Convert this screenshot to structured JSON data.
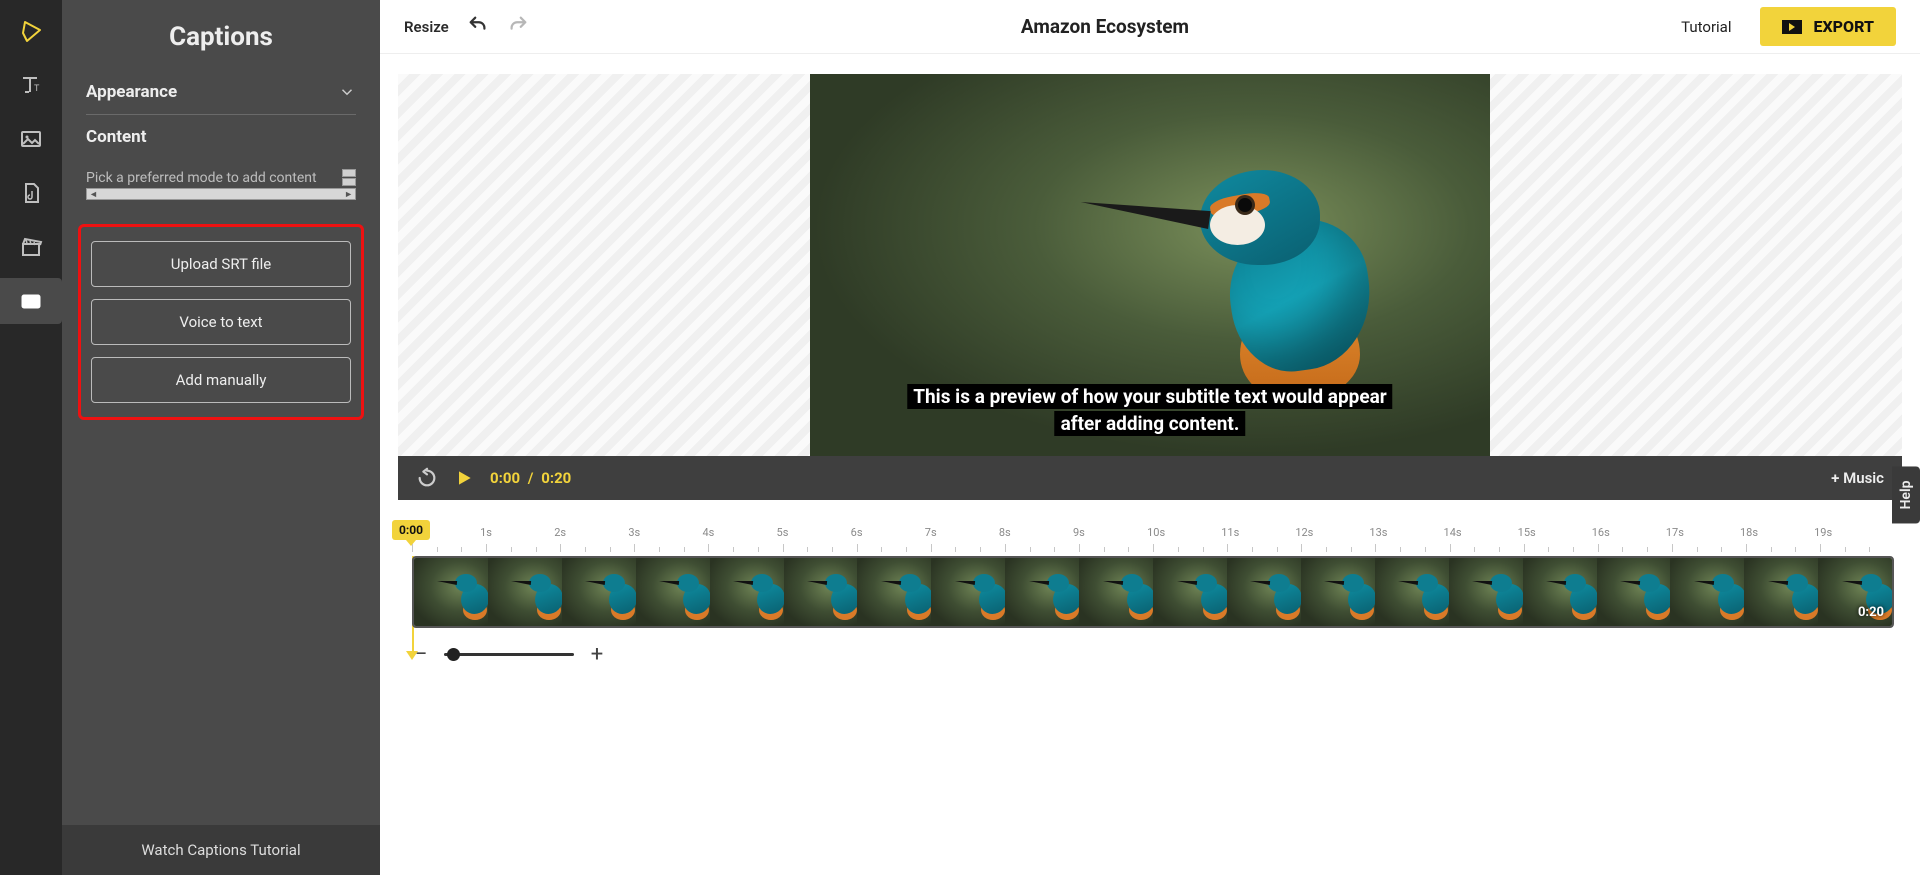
{
  "rail": {
    "icons": [
      "play-outline",
      "text",
      "image",
      "music-file",
      "clapper",
      "captions"
    ]
  },
  "panel": {
    "title": "Captions",
    "appearance_label": "Appearance",
    "content_label": "Content",
    "helper_text": "Pick a preferred mode to add content",
    "buttons": {
      "upload": "Upload SRT file",
      "voice": "Voice to text",
      "manual": "Add manually"
    },
    "footer": "Watch Captions Tutorial"
  },
  "topbar": {
    "resize": "Resize",
    "title": "Amazon Ecosystem",
    "tutorial": "Tutorial",
    "export": "EXPORT"
  },
  "preview": {
    "subtitle_line1": "This is a preview of how your subtitle text would appear",
    "subtitle_line2": "after adding content."
  },
  "player": {
    "current": "0:00",
    "separator": "/",
    "duration": "0:20",
    "music": "+ Music"
  },
  "timeline": {
    "badge": "0:00",
    "end": "0:20",
    "ticks": [
      "1s",
      "2s",
      "3s",
      "4s",
      "5s",
      "6s",
      "7s",
      "8s",
      "9s",
      "10s",
      "11s",
      "12s",
      "13s",
      "14s",
      "15s",
      "16s",
      "17s",
      "18s",
      "19s"
    ]
  },
  "help": "Help"
}
